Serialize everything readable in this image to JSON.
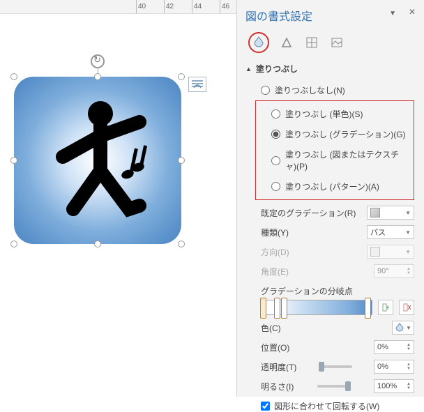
{
  "ruler": {
    "ticks": [
      "40",
      "42",
      "44",
      "46"
    ]
  },
  "panel": {
    "title": "図の書式設定",
    "section": "塗りつぶし",
    "radios": {
      "none": "塗りつぶしなし(N)",
      "solid": "塗りつぶし (単色)(S)",
      "gradient": "塗りつぶし (グラデーション)(G)",
      "picture": "塗りつぶし (図またはテクスチャ)(P)",
      "pattern": "塗りつぶし (パターン)(A)"
    },
    "labels": {
      "preset": "既定のグラデーション(R)",
      "type": "種類(Y)",
      "type_value": "パス",
      "direction": "方向(D)",
      "angle": "角度(E)",
      "angle_value": "90°",
      "stops": "グラデーションの分岐点",
      "color": "色(C)",
      "position": "位置(O)",
      "position_value": "0%",
      "transparency": "透明度(T)",
      "transparency_value": "0%",
      "brightness": "明るさ(I)",
      "brightness_value": "100%",
      "rotate": "図形に合わせて回転する(W)"
    }
  }
}
